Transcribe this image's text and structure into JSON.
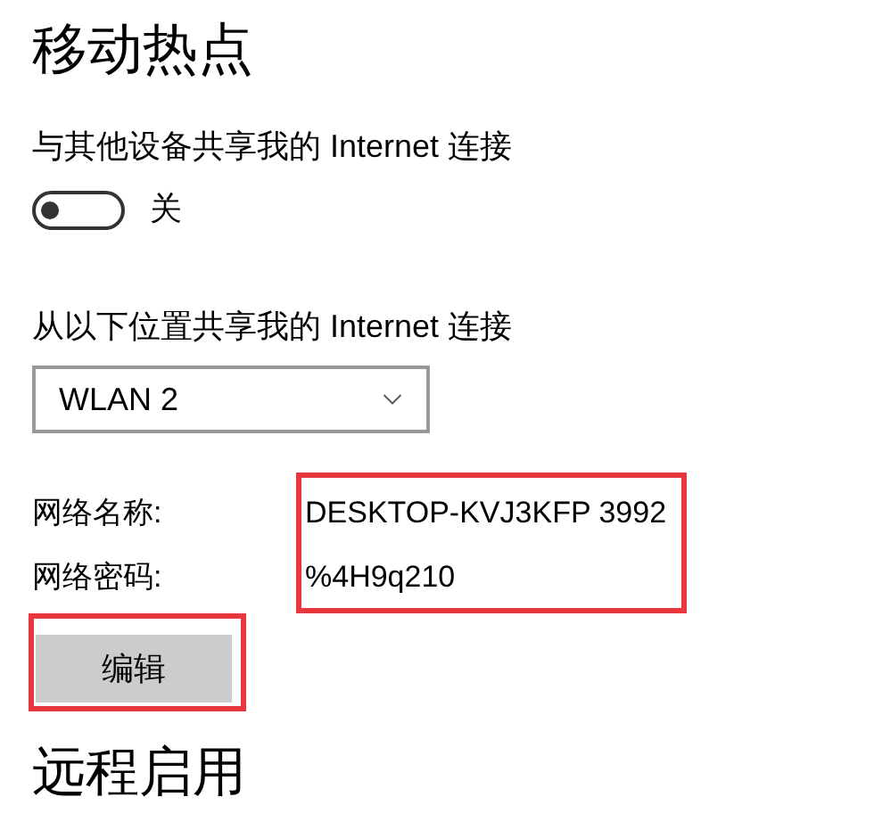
{
  "title": "移动热点",
  "share": {
    "label": "与其他设备共享我的 Internet 连接",
    "on": false,
    "state_text": "关"
  },
  "source": {
    "label": "从以下位置共享我的 Internet 连接",
    "value": "WLAN 2"
  },
  "network": {
    "highlighted": true,
    "fields": [
      {
        "label": "网络名称:",
        "value": "DESKTOP-KVJ3KFP 3992"
      },
      {
        "label": "网络密码:",
        "value": "%4H9q210"
      }
    ]
  },
  "edit_button": {
    "label": "编辑",
    "highlighted": true
  },
  "next_section": "远程启用"
}
